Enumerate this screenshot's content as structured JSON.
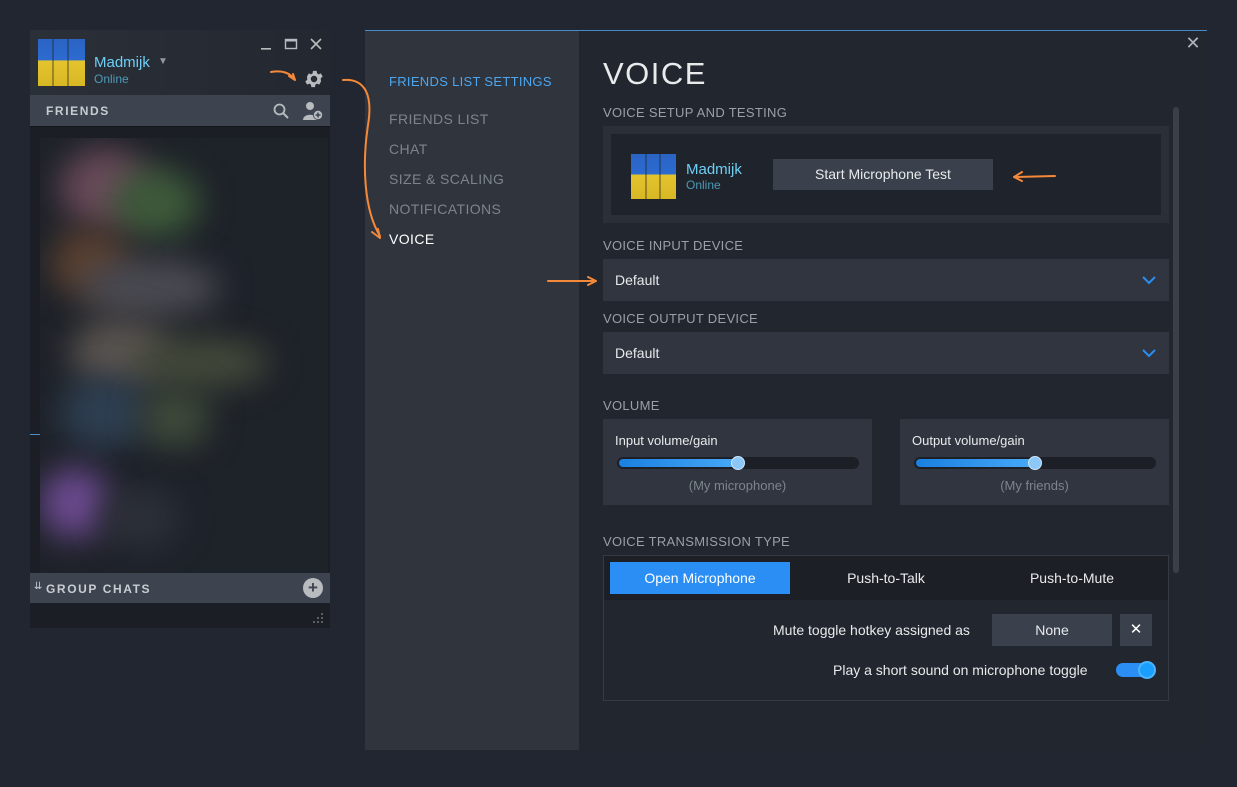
{
  "colors": {
    "accent": "#2a8ef5",
    "link": "#4ca6f0",
    "username": "#6dcff6",
    "annotation": "#f5893a"
  },
  "friends_panel": {
    "username": "Madmijk",
    "status": "Online",
    "friends_label": "FRIENDS",
    "group_chats_label": "GROUP CHATS",
    "icons": {
      "minimize": "minimize-icon",
      "maximize": "maximize-icon",
      "close": "close-icon",
      "settings": "gear-icon",
      "search": "search-icon",
      "add_friend": "add-friend-icon"
    }
  },
  "settings": {
    "nav": {
      "heading": "FRIENDS LIST SETTINGS",
      "items": [
        "FRIENDS LIST",
        "CHAT",
        "SIZE & SCALING",
        "NOTIFICATIONS",
        "VOICE"
      ],
      "active": "VOICE"
    },
    "title": "VOICE",
    "setup": {
      "section": "VOICE SETUP AND TESTING",
      "username": "Madmijk",
      "status": "Online",
      "button": "Start Microphone Test"
    },
    "input_device": {
      "section": "VOICE INPUT DEVICE",
      "value": "Default"
    },
    "output_device": {
      "section": "VOICE OUTPUT DEVICE",
      "value": "Default"
    },
    "volume": {
      "section": "VOLUME",
      "input": {
        "label": "Input volume/gain",
        "sub": "(My microphone)",
        "level": 0.5
      },
      "output": {
        "label": "Output volume/gain",
        "sub": "(My friends)",
        "level": 0.5
      }
    },
    "transmission": {
      "section": "VOICE TRANSMISSION TYPE",
      "tabs": [
        "Open Microphone",
        "Push-to-Talk",
        "Push-to-Mute"
      ],
      "active": "Open Microphone",
      "hotkey_label": "Mute toggle hotkey assigned as",
      "hotkey_value": "None",
      "hotkey_clear": "✕",
      "sound_label": "Play a short sound on microphone toggle",
      "sound_enabled": true
    },
    "close_glyph": "✕"
  }
}
